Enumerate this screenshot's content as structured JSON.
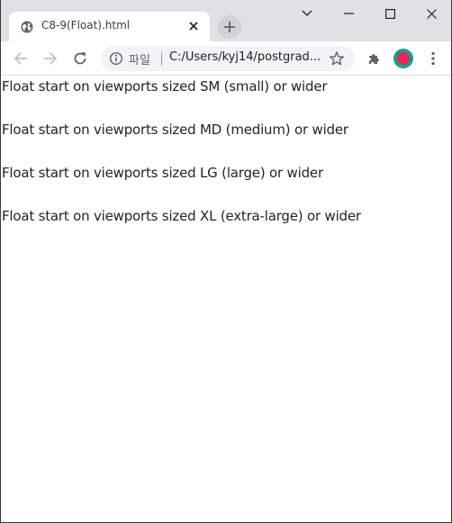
{
  "browser": {
    "tab": {
      "title": "C8-9(Float).html",
      "favicon": "globe-icon",
      "close_icon": "close-icon"
    },
    "new_tab_icon": "plus-icon",
    "window_controls": [
      "chevron-down-icon",
      "minimize-icon",
      "maximize-icon",
      "close-icon"
    ],
    "toolbar": {
      "back_icon": "arrow-left-icon",
      "forward_icon": "arrow-right-icon",
      "reload_icon": "reload-icon",
      "site_info_icon": "info-icon",
      "scheme_label": "파일",
      "url": "C:/Users/kyj14/postgrad...",
      "bookmark_icon": "star-icon",
      "extensions_icon": "puzzle-icon",
      "menu_icon": "kebab-menu-icon"
    }
  },
  "page": {
    "lines": [
      "Float start on viewports sized SM (small) or wider",
      "Float start on viewports sized MD (medium) or wider",
      "Float start on viewports sized LG (large) or wider",
      "Float start on viewports sized XL (extra-large) or wider"
    ]
  },
  "colors": {
    "tabstrip": "#dee1e6",
    "omnibox": "#f1f3f4",
    "profile_ring": "#16a085",
    "profile_fill": "#e8265e",
    "text": "#212529"
  }
}
